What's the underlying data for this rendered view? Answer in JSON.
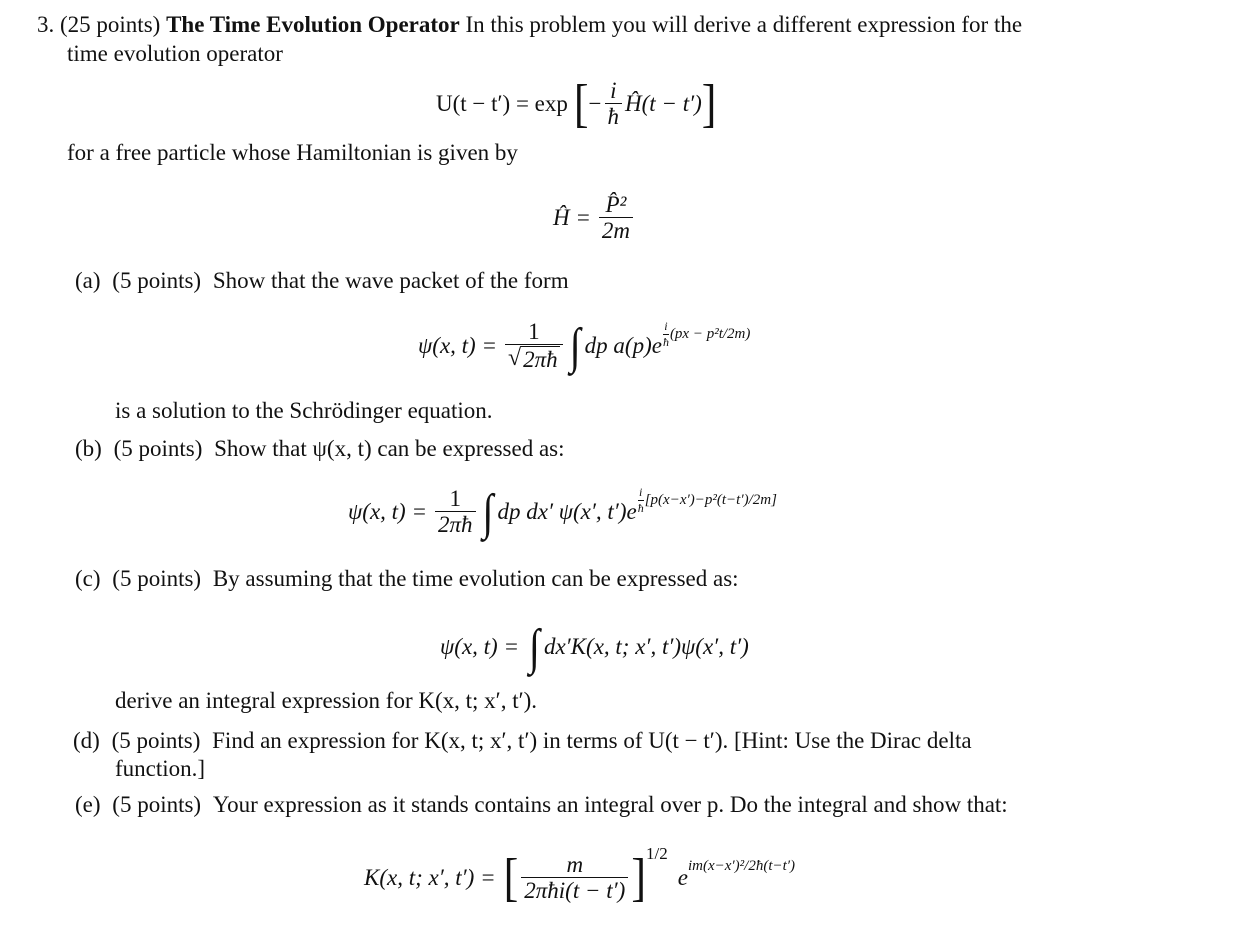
{
  "problem": {
    "number": "3.",
    "points": "(25 points)",
    "title": "The Time Evolution Operator",
    "intro_line1": "In this problem you will derive a different expression for the",
    "intro_line2": "time evolution operator",
    "eq_U": {
      "lhs": "U(t − t′) = exp",
      "inner_minus": "−",
      "num": "i",
      "den": "ħ",
      "rest": "Ĥ(t − t′)"
    },
    "free_particle_text": "for a free particle whose Hamiltonian is given by",
    "eq_H": {
      "lhs": "Ĥ =",
      "num": "P̂²",
      "den": "2m"
    }
  },
  "parts": [
    {
      "label": "(a)",
      "points": "(5 points)",
      "text": "Show that the wave packet of the form",
      "eq": {
        "lhs": "ψ(x, t) =",
        "num": "1",
        "den_root": "2πħ",
        "body": "dp a(p)e",
        "exponent_rest": "(px − p²t/2m)"
      },
      "after": "is a solution to the Schrödinger equation."
    },
    {
      "label": "(b)",
      "points": "(5 points)",
      "text": "Show that ψ(x, t) can be expressed as:",
      "eq": {
        "lhs": "ψ(x, t) =",
        "num": "1",
        "den": "2πħ",
        "body": "dp dx′ ψ(x′, t′)e",
        "exponent_rest": "[p(x−x′)−p²(t−t′)/2m]"
      }
    },
    {
      "label": "(c)",
      "points": "(5 points)",
      "text": "By assuming that the time evolution can be expressed as:",
      "eq": {
        "lhs": "ψ(x, t) =",
        "body": "dx′K(x, t; x′, t′)ψ(x′, t′)"
      },
      "after": "derive an integral expression for K(x, t; x′, t′)."
    },
    {
      "label": "(d)",
      "points": "(5 points)",
      "text_line1": "Find an expression for K(x, t; x′, t′) in terms of U(t − t′).  [Hint: Use the Dirac delta",
      "text_line2": "function.]"
    },
    {
      "label": "(e)",
      "points": "(5 points)",
      "text": "Your expression as it stands contains an integral over p. Do the integral and show that:",
      "eq": {
        "lhs": "K(x, t; x′, t′) =",
        "num": "m",
        "den": "2πħi(t − t′)",
        "power": "1/2",
        "exp_base": "e",
        "exponent": "im(x−x′)²/2ħ(t−t′)"
      }
    }
  ]
}
